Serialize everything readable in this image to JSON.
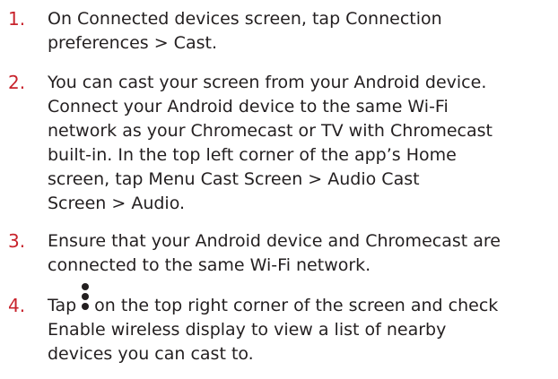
{
  "steps": [
    {
      "number": "1.",
      "lines": [
        "On Connected devices screen, tap Connection",
        "preferences > Cast."
      ]
    },
    {
      "number": "2.",
      "lines": [
        "You can cast your screen from your Android device.",
        "Connect your Android device to the same Wi-Fi",
        "network as your Chromecast or TV with Chromecast",
        "built-in. In the top left corner of the app’s Home",
        "screen, tap Menu Cast Screen > Audio Cast",
        "Screen > Audio."
      ]
    },
    {
      "number": "3.",
      "lines": [
        "Ensure that your Android device and Chromecast are",
        "connected to the same Wi-Fi network."
      ]
    },
    {
      "number": "4.",
      "first_line_before_icon": "Tap",
      "first_line_after_icon": "on the top right corner of the screen and check",
      "icon": "more-vert-icon",
      "lines_rest": [
        "Enable wireless display to view a list of nearby",
        "devices you can cast to."
      ]
    }
  ],
  "colors": {
    "number": "#c8232c",
    "text": "#231f20"
  }
}
